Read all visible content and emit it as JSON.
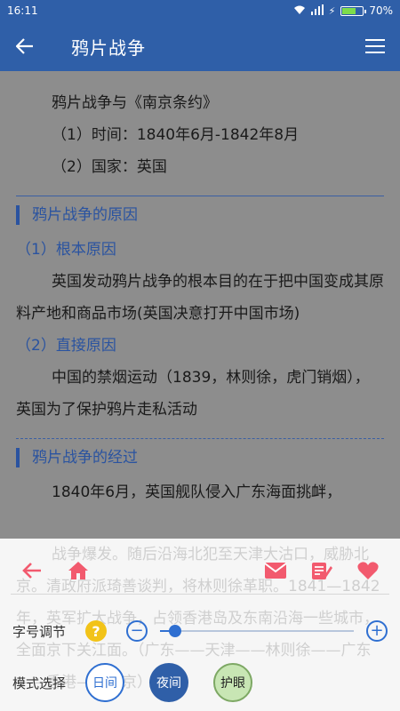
{
  "status_bar": {
    "time": "16:11",
    "battery": "70%",
    "battery_level": 0.7
  },
  "app_bar": {
    "title": "鸦片战争"
  },
  "content": {
    "intro": [
      "鸦片战争与《南京条约》",
      "（1）时间：1840年6月-1842年8月",
      "（2）国家：英国"
    ],
    "section1": {
      "title": "鸦片战争的原因",
      "sub1": "（1）根本原因",
      "para1": "英国发动鸦片战争的根本目的在于把中国变成其原料产地和商品市场(英国决意打开中国市场)",
      "sub2": "（2）直接原因",
      "para2": "中国的禁烟运动（1839，林则徐，虎门销烟），英国为了保护鸦片走私活动"
    },
    "section2": {
      "title": "鸦片战争的经过",
      "para1": "1840年6月，英国舰队侵入广东海面挑衅，"
    },
    "obscured_text": "战争爆发。随后沿海北犯至天津大沽口，威胁北京。清政府派琦善谈判，将林则徐革职。1841—1842年，英军扩大战争，占领香港岛及东南沿海一些城市，全面京下关江面。（广东——天津——林则徐——广东——香港——南京）"
  },
  "panel": {
    "font_label": "字号调节",
    "help_symbol": "?",
    "minus_symbol": "−",
    "plus_symbol": "+",
    "font_level": 0.08,
    "mode_label": "模式选择",
    "modes": {
      "day": "日间",
      "night": "夜间",
      "eye": "护眼"
    }
  },
  "colors": {
    "primary": "#2f5fa8",
    "accent": "#f25a6e",
    "help": "#f2c318"
  }
}
